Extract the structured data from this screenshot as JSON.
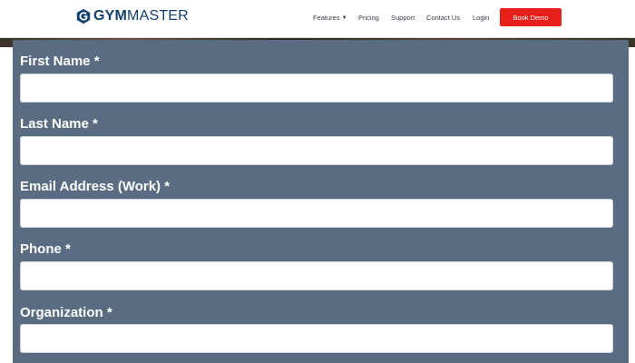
{
  "header": {
    "logo": {
      "brand_bold": "GYM",
      "brand_regular": "MASTER",
      "icon": "gymmaster-g-logo-icon"
    },
    "nav": {
      "features": "Features",
      "pricing": "Pricing",
      "support": "Support",
      "contact": "Contact Us",
      "login": "Login"
    },
    "cta": "Book Demo",
    "colors": {
      "brand": "#123f6e",
      "cta": "#e8201c"
    }
  },
  "form": {
    "background_color": "#5a6c82",
    "fields": [
      {
        "label": "First Name *",
        "value": "",
        "placeholder": ""
      },
      {
        "label": "Last Name *",
        "value": "",
        "placeholder": ""
      },
      {
        "label": "Email Address (Work) *",
        "value": "",
        "placeholder": ""
      },
      {
        "label": "Phone *",
        "value": "",
        "placeholder": ""
      },
      {
        "label": "Organization *",
        "value": "",
        "placeholder": ""
      }
    ]
  }
}
